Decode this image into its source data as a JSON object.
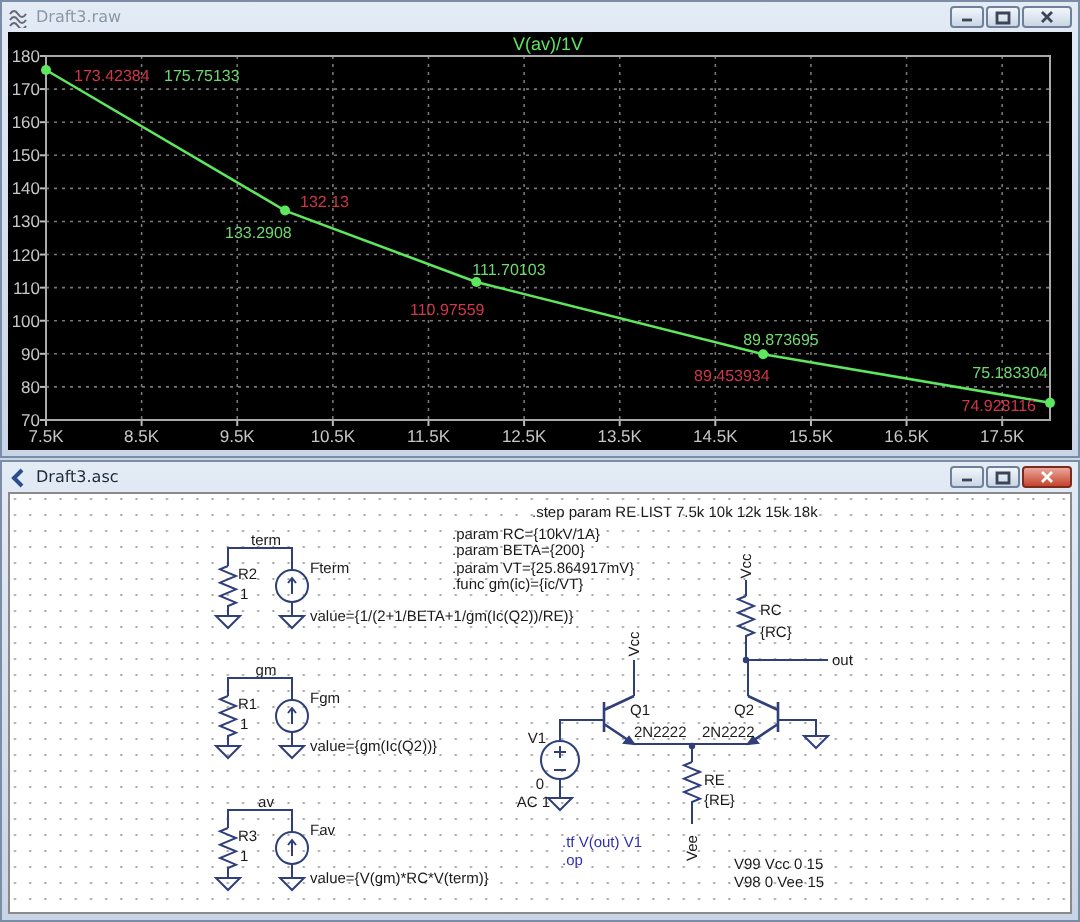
{
  "windows": [
    {
      "title": "Draft3.raw",
      "active": false
    },
    {
      "title": "Draft3.asc",
      "active": true
    }
  ],
  "plot": {
    "chart_data": {
      "type": "line",
      "grid": true,
      "x": [
        7500,
        10000,
        12000,
        15000,
        18000
      ],
      "series": [
        {
          "name": "V(av)/1V",
          "color": "#5ee65e",
          "marker": true,
          "values": [
            175.75133,
            133.2908,
            111.70103,
            89.873695,
            75.183304
          ]
        }
      ],
      "xlim": [
        7500,
        18000
      ],
      "ylim": [
        70,
        180
      ],
      "xticks": [
        {
          "value": 7500,
          "label": "7.5K"
        },
        {
          "value": 8500,
          "label": "8.5K"
        },
        {
          "value": 9500,
          "label": "9.5K"
        },
        {
          "value": 10500,
          "label": "10.5K"
        },
        {
          "value": 11500,
          "label": "11.5K"
        },
        {
          "value": 12500,
          "label": "12.5K"
        },
        {
          "value": 13500,
          "label": "13.5K"
        },
        {
          "value": 14500,
          "label": "14.5K"
        },
        {
          "value": 15500,
          "label": "15.5K"
        },
        {
          "value": 16500,
          "label": "16.5K"
        },
        {
          "value": 17500,
          "label": "17.5K"
        }
      ],
      "yticks": [
        70,
        80,
        90,
        100,
        110,
        120,
        130,
        140,
        150,
        160,
        170,
        180
      ],
      "value_labels": [
        null,
        "133.2908",
        "111.70103",
        "89.873695",
        "75.183304"
      ],
      "annotations": [
        "173.42384",
        "175.75133",
        "132.13",
        "110.97559",
        "89.453934",
        "74.928116"
      ]
    }
  },
  "schematic": {
    "directives": [
      {
        "text": ".step param RE LIST 7.5k 10k 12k 15k 18k",
        "kind": "directive"
      },
      {
        "text": ".param RC={10kV/1A}",
        "kind": "directive"
      },
      {
        "text": ".param BETA={200}",
        "kind": "directive"
      },
      {
        "text": ".param VT={25.864917mV}",
        "kind": "directive"
      },
      {
        "text": ".func gm(ic)={ic/VT}",
        "kind": "directive"
      },
      {
        "text": ".tf V(out) V1",
        "kind": "comment"
      },
      {
        "text": ".op",
        "kind": "comment"
      },
      {
        "text": "V99 Vcc 0 15",
        "kind": "directive"
      },
      {
        "text": "V98 0 Vee 15",
        "kind": "directive"
      }
    ],
    "probes": [
      {
        "net": "term",
        "resistor": "R2",
        "resistor_value": "1",
        "source": "Fterm",
        "expression": "value={1/(2+1/BETA+1/gm(Ic(Q2))/RE)}"
      },
      {
        "net": "gm",
        "resistor": "R1",
        "resistor_value": "1",
        "source": "Fgm",
        "expression": "value={gm(Ic(Q2))}"
      },
      {
        "net": "av",
        "resistor": "R3",
        "resistor_value": "1",
        "source": "Fav",
        "expression": "value={V(gm)*RC*V(term)}"
      }
    ],
    "supply_labels": [
      "Vcc",
      "Vcc",
      "Vee"
    ],
    "output_label": "out",
    "transistors": [
      {
        "name": "Q1",
        "model": "2N2222"
      },
      {
        "name": "Q2",
        "model": "2N2222"
      }
    ],
    "resistors": [
      {
        "name": "RC",
        "value": "{RC}"
      },
      {
        "name": "RE",
        "value": "{RE}"
      }
    ],
    "source": {
      "name": "V1",
      "value": "0",
      "ac": "AC 1"
    }
  }
}
